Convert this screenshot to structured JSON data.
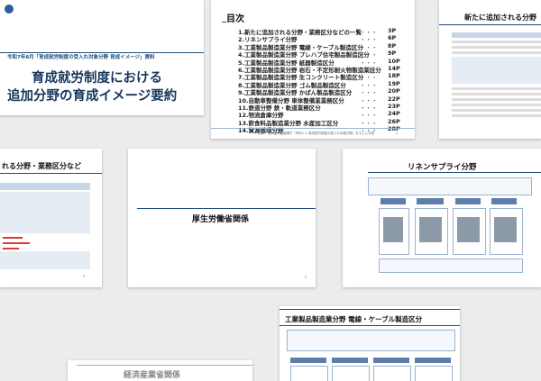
{
  "slides": {
    "title": {
      "header": "令和7年8月「育成就労制度の受入れ対象分野 育成イメージ」資料",
      "line1": "育成就労制度における",
      "line2": "追加分野の育成イメージ要約"
    },
    "toc": {
      "heading": "目次",
      "items": [
        {
          "label": "1.新たに追加される分野・業務区分などの一覧",
          "page": "3P"
        },
        {
          "label": "2.リネンサプライ分野",
          "page": "6P"
        },
        {
          "label": "3.工業製品製造業分野 電線・ケーブル製造区分",
          "page": "8P"
        },
        {
          "label": "4.工業製品製造業分野 プレハブ住宅製品製造区分",
          "page": "9P"
        },
        {
          "label": "5.工業製品製造業分野 紙器製造区分",
          "page": "10P"
        },
        {
          "label": "6.工業製品製造業分野 岩石・不定形耐火物製造業区分",
          "page": "14P"
        },
        {
          "label": "7.工業製品製造業分野 生コンクリート製造区分",
          "page": "18P"
        },
        {
          "label": "8.工業製品製造業分野 ゴム製品製造区分",
          "page": "19P"
        },
        {
          "label": "9.工業製品製造業分野 かばん製品製造区分",
          "page": "20P"
        },
        {
          "label": "10.自動車整備分野 車体整備業業務区分",
          "page": "22P"
        },
        {
          "label": "11.鉄道分野 鉄・軌道業務区分",
          "page": "23P"
        },
        {
          "label": "12.物流倉庫分野",
          "page": "24P"
        },
        {
          "label": "13.飲食料品製造業分野 水産加工区分",
          "page": "26P"
        },
        {
          "label": "14.資源循環分野",
          "page": "28P"
        }
      ],
      "dots": "・・・",
      "footer": "出典：出入国在留管理庁「資料1-1 育成就労制度の受入れ対象分野」をもとに作成",
      "page": "2"
    },
    "new_fields": {
      "title": "新たに追加される分野"
    },
    "fields_list": {
      "title": "れる分野・業務区分など",
      "page": "5"
    },
    "mhlw": {
      "title": "厚生労働省関係",
      "page": "5"
    },
    "linen": {
      "title": "リネンサプライ分野",
      "page": "6"
    },
    "electric": {
      "title": "工業製品製造業分野 電線・ケーブル製造区分"
    },
    "meti": {
      "title": "経済産業省関係"
    }
  },
  "colors": {
    "accent": "#1f4e79",
    "title_blue": "#17365d",
    "red": "#d93a3a"
  }
}
